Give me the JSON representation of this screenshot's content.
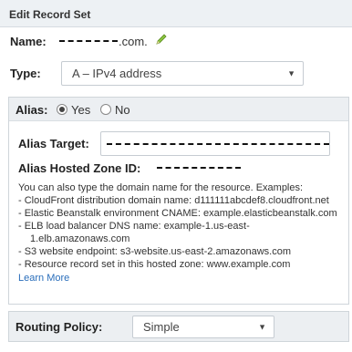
{
  "panel": {
    "title": "Edit Record Set"
  },
  "name": {
    "label": "Name:",
    "suffix": ".com."
  },
  "type": {
    "label": "Type:",
    "selected": "A – IPv4 address"
  },
  "alias": {
    "label": "Alias:",
    "options": [
      {
        "label": "Yes",
        "selected": true
      },
      {
        "label": "No",
        "selected": false
      }
    ],
    "target_label": "Alias Target:",
    "hosted_zone_label": "Alias Hosted Zone ID:",
    "help_intro": "You can also type the domain name for the resource. Examples:",
    "help_items": [
      "-  CloudFront distribution domain name: d111111abcdef8.cloudfront.net",
      "-  Elastic Beanstalk environment CNAME: example.elasticbeanstalk.com",
      "-  ELB load balancer DNS name: example-1.us-east-",
      "1.elb.amazonaws.com",
      "-  S3 website endpoint: s3-website.us-east-2.amazonaws.com",
      "-  Resource record set in this hosted zone: www.example.com"
    ],
    "learn_more": "Learn More"
  },
  "routing": {
    "label": "Routing Policy:",
    "selected": "Simple"
  }
}
